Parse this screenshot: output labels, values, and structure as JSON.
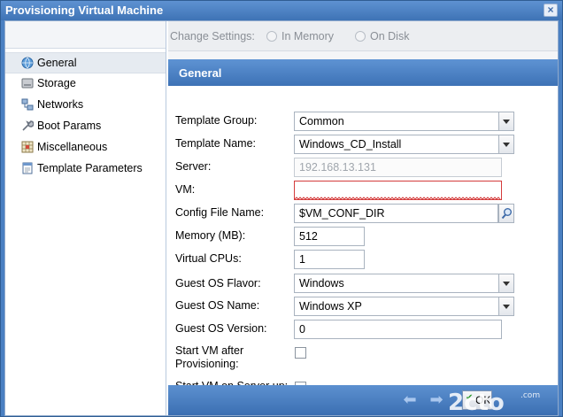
{
  "window": {
    "title": "Provisioning Virtual Machine"
  },
  "sidebar": {
    "items": [
      {
        "label": "General",
        "icon": "globe-icon",
        "active": true
      },
      {
        "label": "Storage",
        "icon": "disk-icon"
      },
      {
        "label": "Networks",
        "icon": "network-icon"
      },
      {
        "label": "Boot Params",
        "icon": "wrench-icon"
      },
      {
        "label": "Miscellaneous",
        "icon": "grid-icon"
      },
      {
        "label": "Template Parameters",
        "icon": "template-icon"
      }
    ]
  },
  "settings": {
    "label": "Change Settings:",
    "options": [
      "In Memory",
      "On Disk"
    ]
  },
  "section": {
    "title": "General"
  },
  "form": {
    "template_group": {
      "label": "Template Group:",
      "value": "Common"
    },
    "template_name": {
      "label": "Template Name:",
      "value": "Windows_CD_Install"
    },
    "server": {
      "label": "Server:",
      "value": "192.168.13.131"
    },
    "vm": {
      "label": "VM:",
      "value": ""
    },
    "config_file": {
      "label": "Config File Name:",
      "value": "$VM_CONF_DIR"
    },
    "memory": {
      "label": "Memory (MB):",
      "value": "512"
    },
    "vcpus": {
      "label": "Virtual CPUs:",
      "value": "1"
    },
    "os_flavor": {
      "label": "Guest OS Flavor:",
      "value": "Windows"
    },
    "os_name": {
      "label": "Guest OS Name:",
      "value": "Windows XP"
    },
    "os_version": {
      "label": "Guest OS Version:",
      "value": "0"
    },
    "start_after": {
      "label_line1": "Start VM after",
      "label_line2": "Provisioning:"
    },
    "start_on_server": {
      "label": "Start VM on Server up:"
    }
  },
  "footer": {
    "ok_label": "OK"
  },
  "colors": {
    "accent": "#4a80c2",
    "invalid": "#d43c3c"
  }
}
